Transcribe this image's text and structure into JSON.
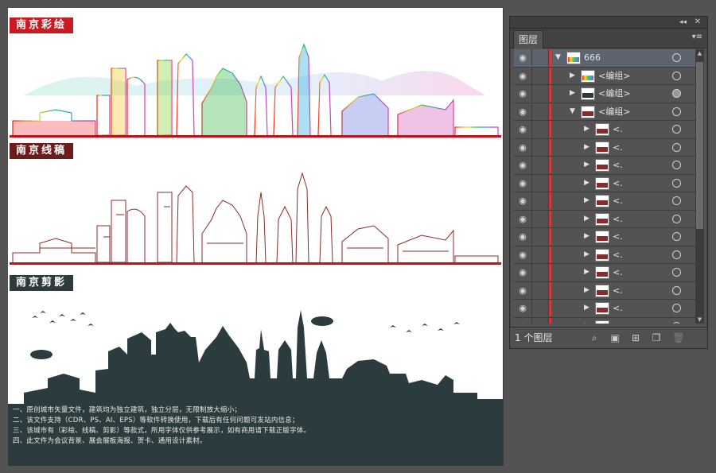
{
  "artboard": {
    "section_color_title": "南京彩绘",
    "section_line_title": "南京线稿",
    "section_silhouette_title": "南京剪影",
    "description_lines": [
      "一、原创城市矢量文件，建筑均为独立建筑，独立分层，无限制放大缩小；",
      "二、该文件支持（CDR、PS、AI、EPS）等软件转换使用，下载后有任何问题可发站内信息；",
      "三、该城市有（彩绘、线稿、剪影）等款式，所用字体仅供参考展示，如有商用请下载正版字体。",
      "四、此文件为会议背景、展会展板海报、贺卡、通用设计素材。"
    ],
    "colors": {
      "tag_color": "#c81b24",
      "tag_line": "#6b1d1d",
      "silhouette": "#2c3b3d",
      "line_art": "#8a2b2b"
    }
  },
  "layers_panel": {
    "tab_label": "图层",
    "footer_count": "1 个图层",
    "rows": [
      {
        "label": "666",
        "indent": 0,
        "expanded": true,
        "thumb": "color",
        "selected": true,
        "target_filled": false
      },
      {
        "label": "<编组>",
        "indent": 1,
        "expanded": false,
        "thumb": "color",
        "selected": false,
        "target_filled": false
      },
      {
        "label": "<编组>",
        "indent": 1,
        "expanded": false,
        "thumb": "dark",
        "selected": false,
        "target_filled": true
      },
      {
        "label": "<编组>",
        "indent": 1,
        "expanded": true,
        "thumb": "line",
        "selected": false,
        "target_filled": false
      },
      {
        "label": "<.",
        "indent": 2,
        "expanded": false,
        "thumb": "line",
        "selected": false,
        "target_filled": false
      },
      {
        "label": "<.",
        "indent": 2,
        "expanded": false,
        "thumb": "line",
        "selected": false,
        "target_filled": false
      },
      {
        "label": "<.",
        "indent": 2,
        "expanded": false,
        "thumb": "line",
        "selected": false,
        "target_filled": false
      },
      {
        "label": "<.",
        "indent": 2,
        "expanded": false,
        "thumb": "line",
        "selected": false,
        "target_filled": false
      },
      {
        "label": "<.",
        "indent": 2,
        "expanded": false,
        "thumb": "line",
        "selected": false,
        "target_filled": false
      },
      {
        "label": "<.",
        "indent": 2,
        "expanded": false,
        "thumb": "line",
        "selected": false,
        "target_filled": false
      },
      {
        "label": "<.",
        "indent": 2,
        "expanded": false,
        "thumb": "line",
        "selected": false,
        "target_filled": false
      },
      {
        "label": "<.",
        "indent": 2,
        "expanded": false,
        "thumb": "line",
        "selected": false,
        "target_filled": false
      },
      {
        "label": "<.",
        "indent": 2,
        "expanded": false,
        "thumb": "line",
        "selected": false,
        "target_filled": false
      },
      {
        "label": "<.",
        "indent": 2,
        "expanded": false,
        "thumb": "line",
        "selected": false,
        "target_filled": false
      },
      {
        "label": "<.",
        "indent": 2,
        "expanded": false,
        "thumb": "line",
        "selected": false,
        "target_filled": false
      },
      {
        "label": "<.",
        "indent": 2,
        "expanded": false,
        "thumb": "line",
        "selected": false,
        "target_filled": false
      }
    ],
    "icons": {
      "visibility": "eye-icon",
      "search": "search-icon",
      "clip": "clipping-mask-icon",
      "sublayer": "new-sublayer-icon",
      "new_layer": "new-layer-icon",
      "delete": "trash-icon"
    }
  }
}
